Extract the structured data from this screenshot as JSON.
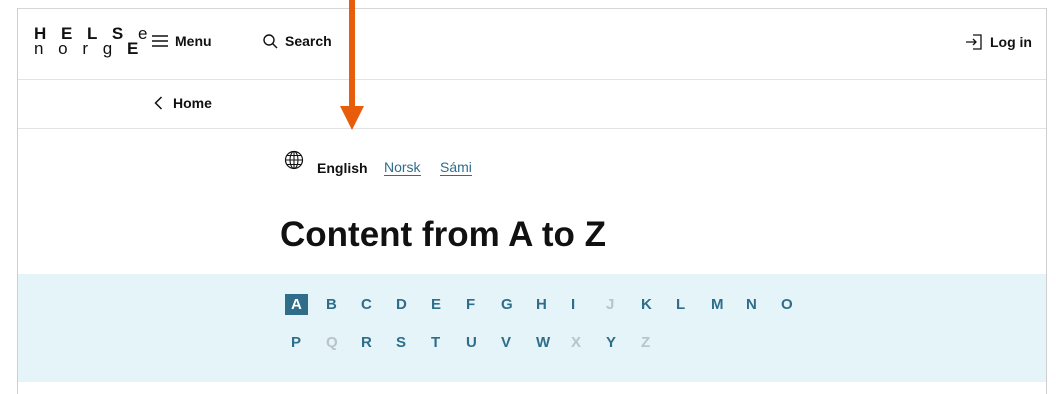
{
  "header": {
    "logo": {
      "line1_bold": "H E L S",
      "line1_thin": "e",
      "line2_thin": "n o r g",
      "line2_bold": "E"
    },
    "menu_label": "Menu",
    "search_label": "Search",
    "login_label": "Log in"
  },
  "breadcrumb": {
    "home_label": "Home"
  },
  "language": {
    "current": "English",
    "options": [
      "Norsk",
      "Sámi"
    ]
  },
  "page": {
    "title": "Content from A to Z"
  },
  "alphabet": {
    "row1": [
      {
        "letter": "A",
        "state": "active"
      },
      {
        "letter": "B",
        "state": "enabled"
      },
      {
        "letter": "C",
        "state": "enabled"
      },
      {
        "letter": "D",
        "state": "enabled"
      },
      {
        "letter": "E",
        "state": "enabled"
      },
      {
        "letter": "F",
        "state": "enabled"
      },
      {
        "letter": "G",
        "state": "enabled"
      },
      {
        "letter": "H",
        "state": "enabled"
      },
      {
        "letter": "I",
        "state": "enabled"
      },
      {
        "letter": "J",
        "state": "disabled"
      },
      {
        "letter": "K",
        "state": "enabled"
      },
      {
        "letter": "L",
        "state": "enabled"
      },
      {
        "letter": "M",
        "state": "enabled"
      },
      {
        "letter": "N",
        "state": "enabled"
      },
      {
        "letter": "O",
        "state": "enabled"
      }
    ],
    "row2": [
      {
        "letter": "P",
        "state": "enabled"
      },
      {
        "letter": "Q",
        "state": "disabled"
      },
      {
        "letter": "R",
        "state": "enabled"
      },
      {
        "letter": "S",
        "state": "enabled"
      },
      {
        "letter": "T",
        "state": "enabled"
      },
      {
        "letter": "U",
        "state": "enabled"
      },
      {
        "letter": "V",
        "state": "enabled"
      },
      {
        "letter": "W",
        "state": "enabled"
      },
      {
        "letter": "X",
        "state": "disabled"
      },
      {
        "letter": "Y",
        "state": "enabled"
      },
      {
        "letter": "Z",
        "state": "disabled"
      }
    ]
  },
  "colors": {
    "accent": "#2f6d8a",
    "band": "#e4f4f8",
    "annotation_arrow": "#e85d0c",
    "disabled": "#b7c4c9"
  },
  "icons": {
    "menu": "hamburger-icon",
    "search": "search-icon",
    "login": "login-icon",
    "back": "chevron-left-icon",
    "language": "globe-icon"
  }
}
